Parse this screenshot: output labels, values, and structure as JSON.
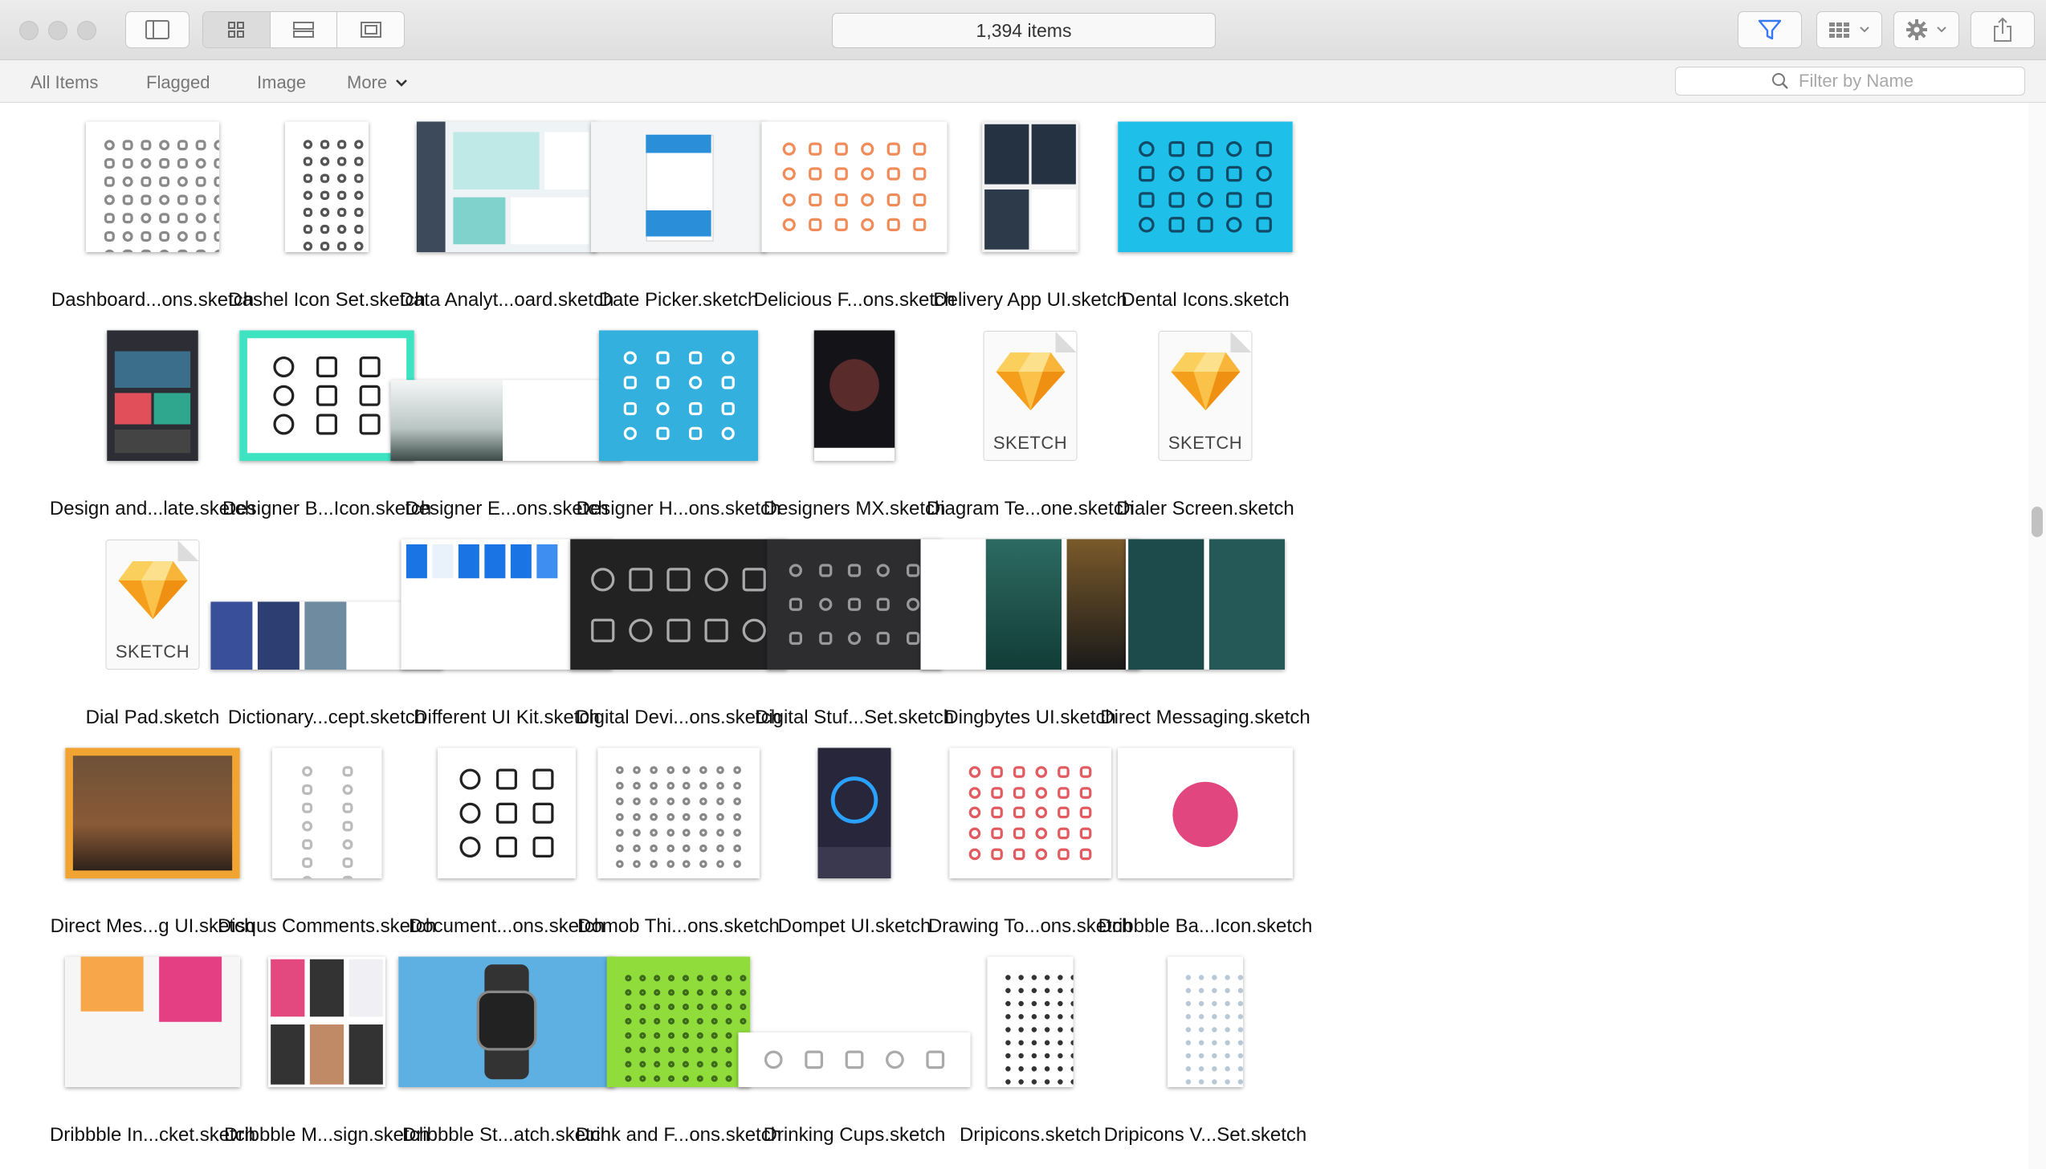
{
  "window": {
    "item_count": "1,394 items"
  },
  "filters": {
    "tabs": [
      "All Items",
      "Flagged",
      "Image",
      "More"
    ],
    "search_placeholder": "Filter by Name"
  },
  "colors": {
    "accent": "#3478f6",
    "sketch_orange": "#f7a823",
    "dental_blue": "#1ec0ea",
    "designer_b_teal": "#3ee3c2",
    "designer_h_blue": "#33b0de",
    "dribbble_pink": "#e2467f",
    "watch_blue": "#5eb0e2",
    "drink_green": "#8fdc3b"
  },
  "items": [
    {
      "name": "Dashboard...ons.sketch",
      "thumb": "icon-sheet-gray"
    },
    {
      "name": "Dashel Icon Set.sketch",
      "thumb": "icon-sheet-tall"
    },
    {
      "name": "Data Analyt...oard.sketch",
      "thumb": "dashboard-teal"
    },
    {
      "name": "Date Picker.sketch",
      "thumb": "date-picker"
    },
    {
      "name": "Delicious F...ons.sketch",
      "thumb": "food-icons"
    },
    {
      "name": "Delivery App UI.sketch",
      "thumb": "app-screens-dark"
    },
    {
      "name": "Dental Icons.sketch",
      "thumb": "dental-blue"
    },
    {
      "name": "Design and...late.sketch",
      "thumb": "design-template"
    },
    {
      "name": "Designer B...Icon.sketch",
      "thumb": "designer-b"
    },
    {
      "name": "Designer E...ons.sketch",
      "thumb": "designer-e"
    },
    {
      "name": "Designer H...ons.sketch",
      "thumb": "designer-h"
    },
    {
      "name": "Designers MX.sketch",
      "thumb": "designers-mx"
    },
    {
      "name": "Diagram Te...one.sketch",
      "thumb": "sketch-file"
    },
    {
      "name": "Dialer Screen.sketch",
      "thumb": "sketch-file"
    },
    {
      "name": "Dial Pad.sketch",
      "thumb": "sketch-file"
    },
    {
      "name": "Dictionary...cept.sketch",
      "thumb": "dictionary"
    },
    {
      "name": "Different UI Kit.sketch",
      "thumb": "ui-kit"
    },
    {
      "name": "Digital Devi...ons.sketch",
      "thumb": "devices-dark"
    },
    {
      "name": "Digital Stuf...Set.sketch",
      "thumb": "digital-stuff"
    },
    {
      "name": "Dingbytes UI.sketch",
      "thumb": "dingbytes"
    },
    {
      "name": "Direct Messaging.sketch",
      "thumb": "direct-messaging"
    },
    {
      "name": "Direct Mes...g UI.sketch",
      "thumb": "mars"
    },
    {
      "name": "Disqus Comments.sketch",
      "thumb": "disqus"
    },
    {
      "name": "Document...ons.sketch",
      "thumb": "document-icons"
    },
    {
      "name": "Domob Thi...ons.sketch",
      "thumb": "domob"
    },
    {
      "name": "Dompet UI.sketch",
      "thumb": "dompet"
    },
    {
      "name": "Drawing To...ons.sketch",
      "thumb": "drawing-tools"
    },
    {
      "name": "Dribbble Ba...Icon.sketch",
      "thumb": "dribbble-ball"
    },
    {
      "name": "Dribbble In...cket.sketch",
      "thumb": "dribbble-invite"
    },
    {
      "name": "Dribbble M...sign.sketch",
      "thumb": "dribbble-m"
    },
    {
      "name": "Dribbble St...atch.sketch",
      "thumb": "watch"
    },
    {
      "name": "Drink and F...ons.sketch",
      "thumb": "drink-green"
    },
    {
      "name": "Drinking Cups.sketch",
      "thumb": "cups"
    },
    {
      "name": "Dripicons.sketch",
      "thumb": "dripicons"
    },
    {
      "name": "Dripicons V...Set.sketch",
      "thumb": "dripicons-v"
    }
  ],
  "sketch_file_label": "SKETCH"
}
